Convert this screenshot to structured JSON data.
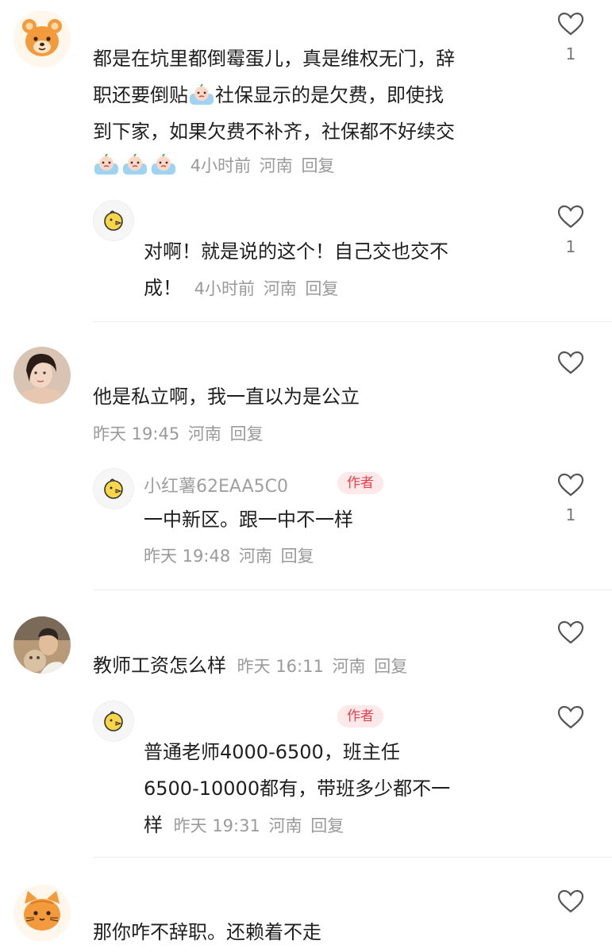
{
  "comments": [
    {
      "text_lines": [
        "都是在坑里都倒霉蛋儿，真是维权无门，辞",
        "社保显示的是欠费，即使找",
        "到下家，如果欠费不补齐，社保都不好续交"
      ],
      "text_line2_prefix": "职还要倒贴",
      "time": "4小时前",
      "location": "河南",
      "reply": "回复",
      "likes": "1",
      "replies": [
        {
          "text_line1": "对啊！就是说的这个！自己交也交不",
          "text_line2": "成！",
          "time": "4小时前",
          "location": "河南",
          "reply": "回复",
          "likes": "1"
        }
      ]
    },
    {
      "text": "他是私立啊，我一直以为是公立",
      "time": "昨天 19:45",
      "location": "河南",
      "reply": "回复",
      "likes": "",
      "replies": [
        {
          "name": "小红薯62EAA5C0",
          "badge": "作者",
          "text": "一中新区。跟一中不一样",
          "time": "昨天 19:48",
          "location": "河南",
          "reply": "回复",
          "likes": "1"
        }
      ]
    },
    {
      "text": "教师工资怎么样",
      "time": "昨天 16:11",
      "location": "河南",
      "reply": "回复",
      "likes": "",
      "replies": [
        {
          "badge": "作者",
          "text_line1": "普通老师4000-6500，班主任",
          "text_line2": "6500-10000都有，带班多少都不一",
          "text_line3": "样",
          "time": "昨天 19:31",
          "location": "河南",
          "reply": "回复",
          "likes": ""
        }
      ]
    },
    {
      "text": "那你咋不辞职。还赖着不走",
      "likes": ""
    }
  ],
  "icons": {
    "like": "heart-outline-icon",
    "emoji": "crying-emoji-icon",
    "author_avatar": "chick-avatar-icon"
  },
  "colors": {
    "badge_text": "#e8414d",
    "badge_bg": "#fde8ea",
    "meta": "#9a9a9a"
  }
}
